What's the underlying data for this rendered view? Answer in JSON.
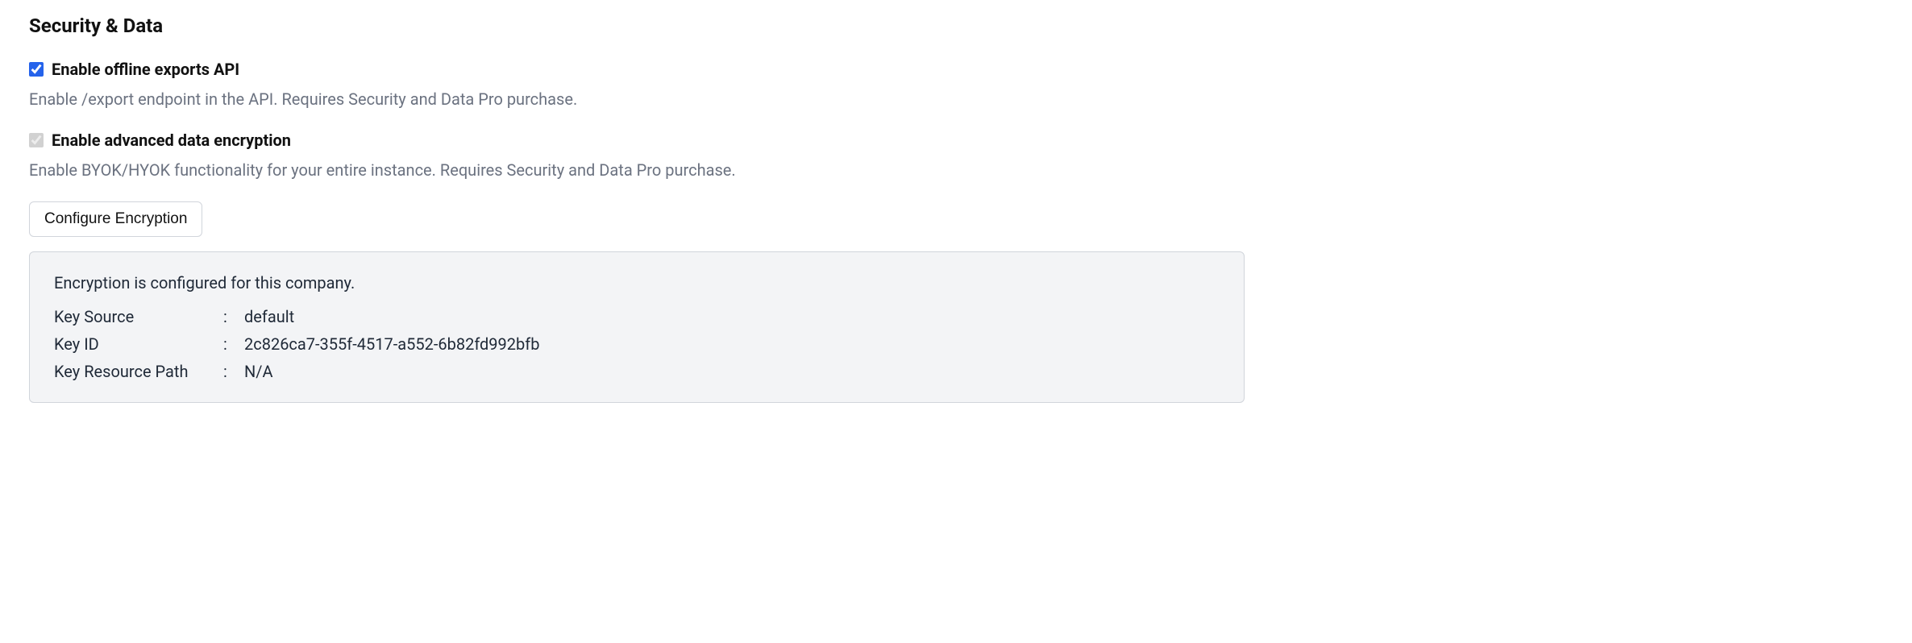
{
  "section": {
    "title": "Security & Data"
  },
  "options": {
    "offlineExports": {
      "label": "Enable offline exports API",
      "description": "Enable /export endpoint in the API. Requires Security and Data Pro purchase.",
      "checked": true,
      "disabled": false
    },
    "advancedEncryption": {
      "label": "Enable advanced data encryption",
      "description": "Enable BYOK/HYOK functionality for your entire instance. Requires Security and Data Pro purchase.",
      "checked": true,
      "disabled": true
    }
  },
  "buttons": {
    "configureEncryption": "Configure Encryption"
  },
  "encryptionInfo": {
    "title": "Encryption is configured for this company.",
    "rows": [
      {
        "label": "Key Source",
        "value": "default"
      },
      {
        "label": "Key ID",
        "value": "2c826ca7-355f-4517-a552-6b82fd992bfb"
      },
      {
        "label": "Key Resource Path",
        "value": "N/A"
      }
    ]
  }
}
